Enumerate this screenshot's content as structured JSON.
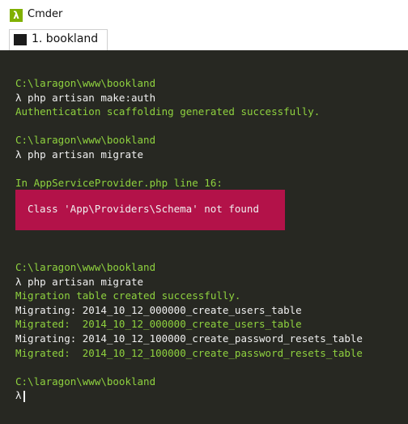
{
  "window": {
    "title": "Cmder",
    "app_icon": "lambda-icon"
  },
  "tab": {
    "label": "1. bookland",
    "icon": "console-icon"
  },
  "terminal": {
    "lines": [
      {
        "text": "C:\\laragon\\www\\bookland",
        "color": "green"
      },
      {
        "text": "λ php artisan make:auth",
        "color": "white"
      },
      {
        "text": "Authentication scaffolding generated successfully.",
        "color": "green"
      },
      {
        "text": "",
        "color": "white"
      },
      {
        "text": "C:\\laragon\\www\\bookland",
        "color": "green"
      },
      {
        "text": "λ php artisan migrate",
        "color": "white"
      },
      {
        "text": "",
        "color": "white"
      },
      {
        "text": "In AppServiceProvider.php line 16:",
        "color": "green"
      }
    ],
    "error": "Class 'App\\Providers\\Schema' not found",
    "lines_after": [
      {
        "text": "C:\\laragon\\www\\bookland",
        "color": "green"
      },
      {
        "text": "λ php artisan migrate",
        "color": "white"
      },
      {
        "text": "Migration table created successfully.",
        "color": "green"
      },
      {
        "text": "Migrating: 2014_10_12_000000_create_users_table",
        "color": "white"
      },
      {
        "text": "Migrated:  2014_10_12_000000_create_users_table",
        "color": "green"
      },
      {
        "text": "Migrating: 2014_10_12_100000_create_password_resets_table",
        "color": "white"
      },
      {
        "text": "Migrated:  2014_10_12_100000_create_password_resets_table",
        "color": "green"
      },
      {
        "text": "",
        "color": "white"
      },
      {
        "text": "C:\\laragon\\www\\bookland",
        "color": "green"
      }
    ],
    "prompt": "λ"
  },
  "colors": {
    "green": "#8fd23f",
    "white": "#f0f0f0",
    "error_bg": "#b31249",
    "background": "#272822"
  }
}
